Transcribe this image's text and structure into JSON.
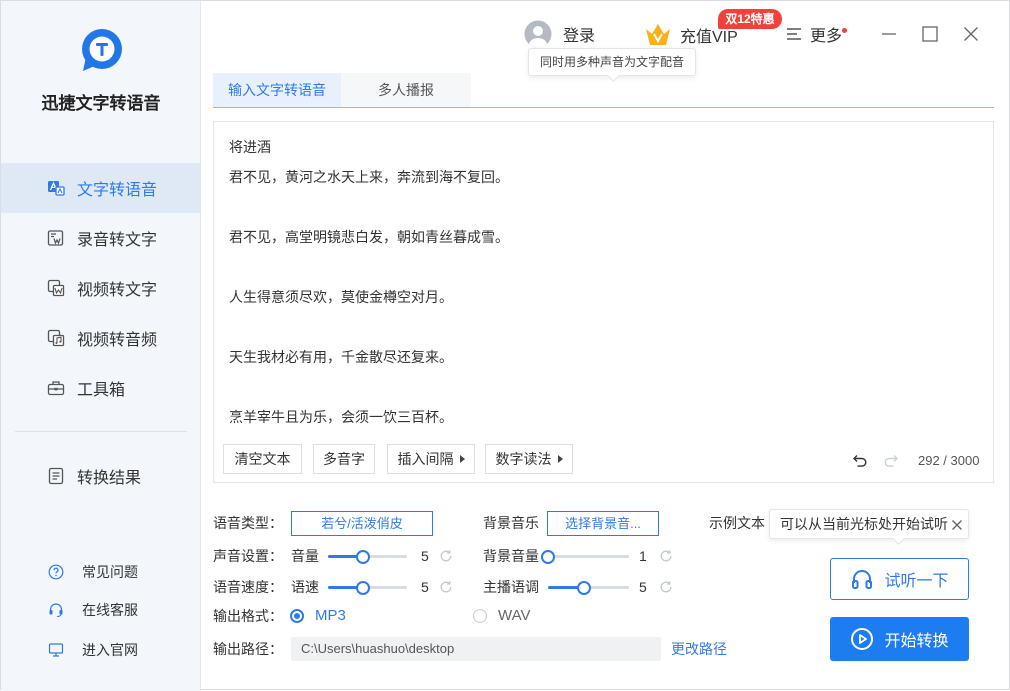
{
  "app": {
    "title": "迅捷文字转语音",
    "logo_icon": "app-logo-icon"
  },
  "sidebar": {
    "nav_items": [
      {
        "label": "文字转语音",
        "icon": "text-to-speech-icon",
        "active": true
      },
      {
        "label": "录音转文字",
        "icon": "record-to-text-icon",
        "active": false
      },
      {
        "label": "视频转文字",
        "icon": "video-to-text-icon",
        "active": false
      },
      {
        "label": "视频转音频",
        "icon": "video-to-audio-icon",
        "active": false
      },
      {
        "label": "工具箱",
        "icon": "toolbox-icon",
        "active": false
      }
    ],
    "result_item": {
      "label": "转换结果",
      "icon": "result-icon"
    },
    "footer_links": [
      {
        "label": "常见问题",
        "icon": "question-icon"
      },
      {
        "label": "在线客服",
        "icon": "headset-icon"
      },
      {
        "label": "进入官网",
        "icon": "monitor-icon"
      }
    ]
  },
  "topbar": {
    "login": {
      "label": "登录",
      "icon": "user-avatar-icon"
    },
    "vip": {
      "label": "充值VIP",
      "icon": "crown-icon",
      "badge": "双12特惠"
    },
    "more": {
      "label": "更多",
      "icon": "menu-icon",
      "has_notification_dot": true
    },
    "window_controls": [
      "minimize-icon",
      "maximize-icon",
      "close-icon"
    ],
    "tooltip": "同时用多种声音为文字配音"
  },
  "tabs": [
    {
      "label": "输入文字转语音",
      "active": true
    },
    {
      "label": "多人播报",
      "active": false
    }
  ],
  "editor": {
    "title": "将进酒",
    "lines": [
      "君不见，黄河之水天上来，奔流到海不复回。",
      "君不见，高堂明镜悲白发，朝如青丝暮成雪。",
      "人生得意须尽欢，莫使金樽空对月。",
      "天生我材必有用，千金散尽还复来。",
      "烹羊宰牛且为乐，会须一饮三百杯。"
    ],
    "tools": [
      {
        "label": "清空文本",
        "has_arrow": false
      },
      {
        "label": "多音字",
        "has_arrow": false
      },
      {
        "label": "插入间隔",
        "has_arrow": true
      },
      {
        "label": "数字读法",
        "has_arrow": true
      }
    ],
    "undo_icon": "undo-icon",
    "redo_icon": "redo-icon",
    "redo_enabled": false,
    "char_count": "292 / 3000"
  },
  "settings": {
    "voice_type": {
      "label": "语音类型：",
      "value": "若兮/活泼俏皮"
    },
    "bg_music": {
      "label": "背景音乐",
      "button": "选择背景音..."
    },
    "sample_text": {
      "label": "示例文本"
    },
    "hint_tooltip": {
      "text": "可以从当前光标处开始试听",
      "close_icon": "close-icon"
    },
    "sound": {
      "label": "声音设置：",
      "volume": {
        "label": "音量",
        "value": 5
      },
      "bg_volume": {
        "label": "背景音量",
        "value": 1
      }
    },
    "speed": {
      "label": "语音速度：",
      "rate": {
        "label": "语速",
        "value": 5
      },
      "tone": {
        "label": "主播语调",
        "value": 5
      }
    },
    "format": {
      "label": "输出格式：",
      "options": [
        {
          "label": "MP3",
          "selected": true
        },
        {
          "label": "WAV",
          "selected": false
        }
      ]
    },
    "output_path": {
      "label": "输出路径：",
      "value": "C:\\Users\\huashuo\\desktop",
      "change_label": "更改路径"
    }
  },
  "actions": {
    "preview": {
      "label": "试听一下",
      "icon": "headphones-icon"
    },
    "convert": {
      "label": "开始转换",
      "icon": "play-circle-icon"
    }
  },
  "colors": {
    "accent": "#2f7ae5",
    "accent_strong": "#1c7cf0",
    "sidebar_bg": "#f3f6fa",
    "active_item_bg": "#dfe8f5",
    "badge_red": "#f2413b",
    "vip_gold": "#f7b21b"
  }
}
